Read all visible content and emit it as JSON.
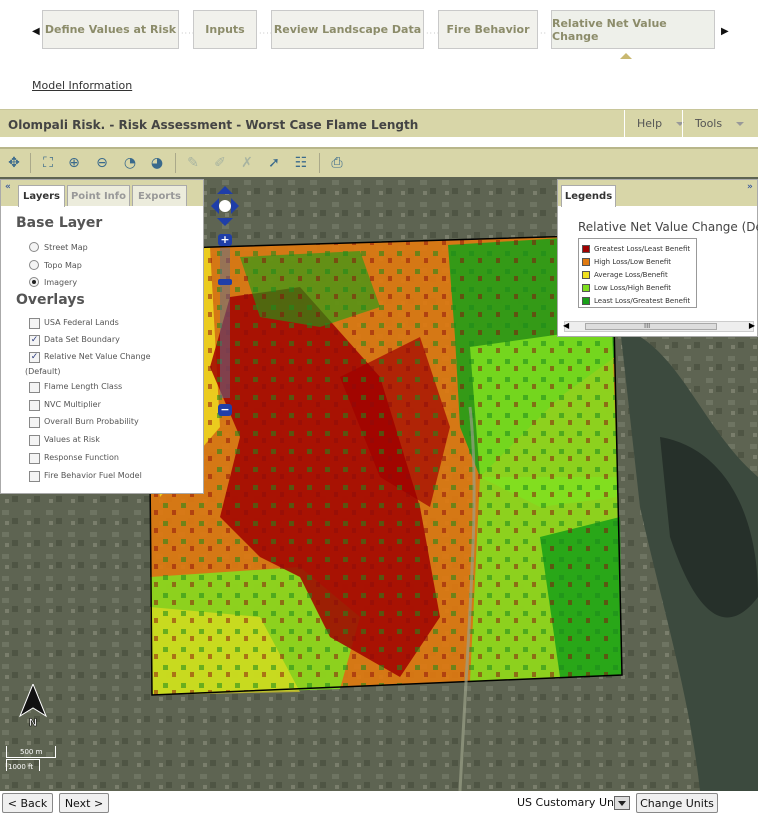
{
  "wizard": {
    "steps": [
      {
        "label": "Define Values at Risk"
      },
      {
        "label": "Inputs"
      },
      {
        "label": "Review Landscape Data"
      },
      {
        "label": "Fire Behavior"
      },
      {
        "label": "Relative Net Value Change"
      }
    ],
    "active_index": 4
  },
  "model_info_link": "Model Information",
  "titlebar": {
    "title": "Olompali Risk. - Risk Assessment - Worst Case Flame Length",
    "help": "Help",
    "tools": "Tools"
  },
  "toolbar_icons": [
    "pan-icon",
    "zoom-extent-icon",
    "zoom-in-icon",
    "zoom-out-icon",
    "zoom-previous-icon",
    "zoom-next-icon",
    "comment-icon",
    "comment-edit-icon",
    "comment-delete-icon",
    "identify-icon",
    "table-icon",
    "print-icon"
  ],
  "layers_panel": {
    "tabs": [
      "Layers",
      "Point Info",
      "Exports"
    ],
    "base_layer_heading": "Base Layer",
    "base_layers": [
      {
        "label": "Street Map",
        "selected": false
      },
      {
        "label": "Topo Map",
        "selected": false
      },
      {
        "label": "Imagery",
        "selected": true
      }
    ],
    "overlays_heading": "Overlays",
    "overlays": [
      {
        "label": "USA Federal Lands",
        "checked": false
      },
      {
        "label": "Data Set Boundary",
        "checked": true
      },
      {
        "label": "Relative Net Value Change",
        "label2": "(Default)",
        "checked": true
      },
      {
        "label": "Flame Length Class",
        "checked": false
      },
      {
        "label": "NVC Multiplier",
        "checked": false
      },
      {
        "label": "Overall Burn Probability",
        "checked": false
      },
      {
        "label": "Values at Risk",
        "checked": false
      },
      {
        "label": "Response Function",
        "checked": false
      },
      {
        "label": "Fire Behavior Fuel Model",
        "checked": false
      }
    ]
  },
  "legend_panel": {
    "tab": "Legends",
    "title": "Relative Net Value Change (De",
    "scroll_label": "III",
    "items": [
      {
        "label": "Greatest Loss/Least Benefit",
        "color": "#a00000"
      },
      {
        "label": "High Loss/Low Benefit",
        "color": "#e07a10"
      },
      {
        "label": "Average Loss/Benefit",
        "color": "#f0e020"
      },
      {
        "label": "Low Loss/High Benefit",
        "color": "#80e020"
      },
      {
        "label": "Least Loss/Greatest Benefit",
        "color": "#18a018"
      }
    ]
  },
  "map": {
    "north_label": "N",
    "scale_top": "500 m",
    "scale_bottom": "1000 ft"
  },
  "bottom": {
    "back": "< Back",
    "next": "Next >",
    "units": "US Customary Units",
    "change_units": "Change Units"
  }
}
